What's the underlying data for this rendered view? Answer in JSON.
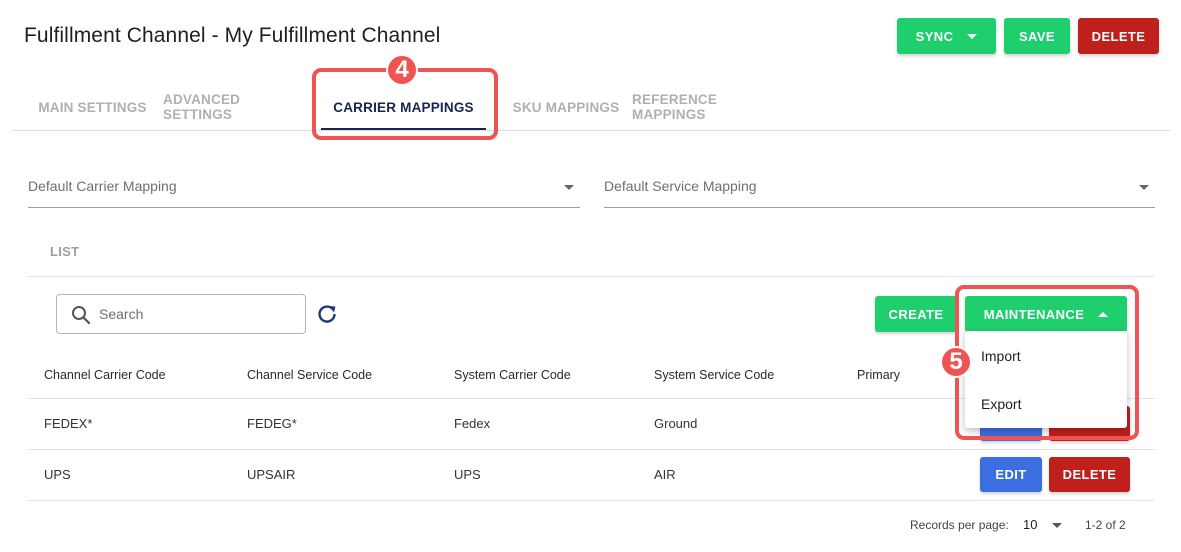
{
  "header": {
    "title": "Fulfillment Channel - My Fulfillment Channel",
    "sync_label": "SYNC",
    "save_label": "SAVE",
    "delete_label": "DELETE"
  },
  "tabs": [
    {
      "label": "MAIN SETTINGS",
      "active": false
    },
    {
      "label": "ADVANCED SETTINGS",
      "active": false
    },
    {
      "label": "CARRIER MAPPINGS",
      "active": true
    },
    {
      "label": "SKU MAPPINGS",
      "active": false
    },
    {
      "label": "REFERENCE MAPPINGS",
      "active": false
    }
  ],
  "mappings": {
    "default_carrier_label": "Default Carrier Mapping",
    "default_service_label": "Default Service Mapping"
  },
  "list": {
    "section_label": "LIST",
    "search_placeholder": "Search",
    "create_label": "CREATE",
    "maintenance_label": "MAINTENANCE",
    "maintenance_menu": [
      "Import",
      "Export"
    ],
    "columns": [
      "Channel Carrier Code",
      "Channel Service Code",
      "System Carrier Code",
      "System Service Code",
      "Primary"
    ],
    "rows": [
      {
        "channel_carrier": "FEDEX*",
        "channel_service": "FEDEG*",
        "system_carrier": "Fedex",
        "system_service": "Ground",
        "primary": "",
        "edit_label": "EDIT",
        "delete_label": "DELETE"
      },
      {
        "channel_carrier": "UPS",
        "channel_service": "UPSAIR",
        "system_carrier": "UPS",
        "system_service": "AIR",
        "primary": "",
        "edit_label": "EDIT",
        "delete_label": "DELETE"
      }
    ]
  },
  "pagination": {
    "records_per_page_label": "Records per page:",
    "records_per_page_value": "10",
    "range": "1-2 of 2"
  },
  "annotations": {
    "marker_tabs": "4",
    "marker_maintenance": "5"
  },
  "colors": {
    "green": "#1fce6d",
    "red": "#c0201c",
    "blue": "#3b6ee0",
    "highlight": "#ef5454",
    "active_tab": "#1a2550"
  }
}
